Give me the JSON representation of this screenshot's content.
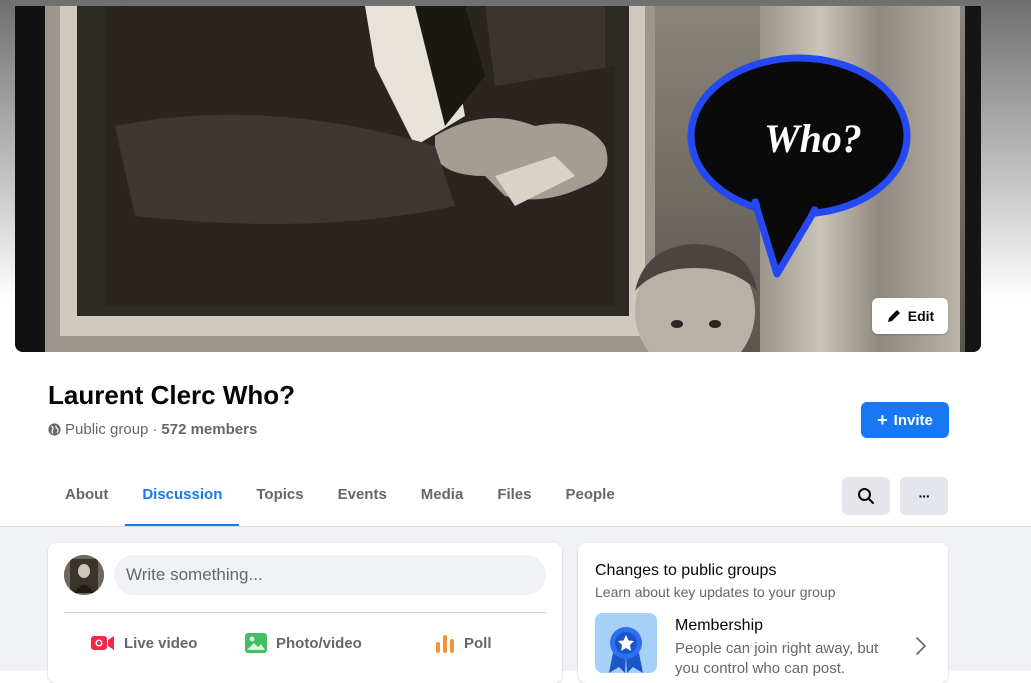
{
  "cover": {
    "speech_bubble_text": "Who?",
    "edit_label": "Edit"
  },
  "group": {
    "name": "Laurent Clerc Who?",
    "privacy": "Public group",
    "separator": "·",
    "members": "572 members",
    "invite_label": "Invite"
  },
  "tabs": [
    {
      "label": "About"
    },
    {
      "label": "Discussion",
      "active": true
    },
    {
      "label": "Topics"
    },
    {
      "label": "Events"
    },
    {
      "label": "Media"
    },
    {
      "label": "Files"
    },
    {
      "label": "People"
    }
  ],
  "tab_actions": {
    "search_icon": "search-icon",
    "more_label": "···"
  },
  "composer": {
    "placeholder": "Write something...",
    "actions": [
      {
        "label": "Live video",
        "icon": "live-video-icon",
        "color": "#f02849"
      },
      {
        "label": "Photo/video",
        "icon": "photo-icon",
        "color": "#45bd62"
      },
      {
        "label": "Poll",
        "icon": "poll-icon",
        "color": "#f7923b"
      }
    ]
  },
  "info_card": {
    "title": "Changes to public groups",
    "subtitle": "Learn about key updates to your group",
    "item_title": "Membership",
    "item_desc": "People can join right away, but you control who can post."
  },
  "colors": {
    "accent": "#1877f2",
    "secondary_text": "#65676b",
    "feed_bg": "#f0f2f5"
  }
}
